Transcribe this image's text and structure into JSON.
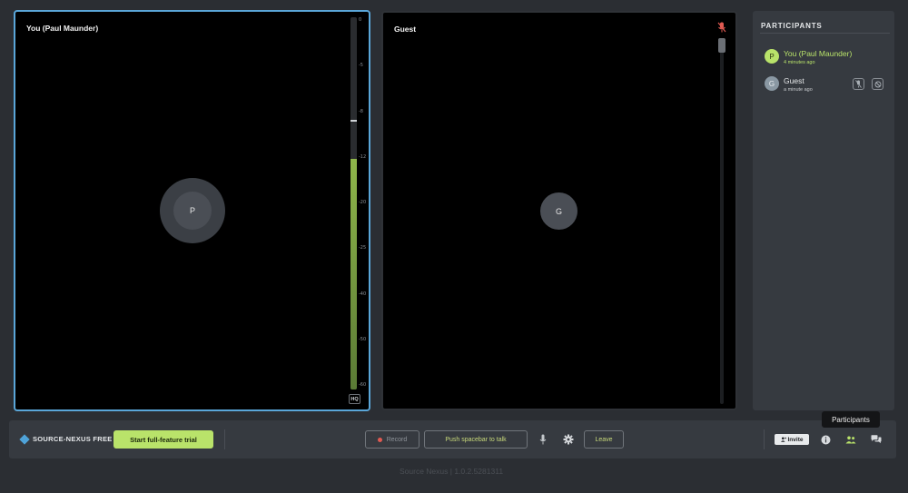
{
  "tiles": {
    "you": {
      "name": "You (Paul Maunder)",
      "initial": "P",
      "hq_label": "HQ"
    },
    "guest": {
      "name": "Guest",
      "initial": "G"
    }
  },
  "meter": {
    "ticks": [
      "0",
      "-5",
      "-8",
      "-12",
      "-20",
      "-25",
      "-40",
      "-50",
      "-60"
    ],
    "level_fraction": 0.62,
    "peak_fraction": 0.72
  },
  "participants": {
    "title": "PARTICIPANTS",
    "items": [
      {
        "name": "You (Paul Maunder)",
        "initial": "P",
        "time": "4 minutes ago",
        "color": "#b9e36a"
      },
      {
        "name": "Guest",
        "initial": "G",
        "time": "a minute ago",
        "color": "#e6e8ea"
      }
    ]
  },
  "toolbar": {
    "brand": "SOURCE-NEXUS FREE",
    "trial_label": "Start full-feature trial",
    "record_label": "Record",
    "ptt_label": "Push spacebar to talk",
    "leave_label": "Leave",
    "invite_label": "Invite"
  },
  "tooltip": "Participants",
  "version": "Source Nexus | 1.0.2.5281311",
  "colors": {
    "accent": "#b9e36a",
    "selected_border": "#5aa6d8",
    "record": "#e05a52",
    "brand": "#4fa3d9"
  }
}
